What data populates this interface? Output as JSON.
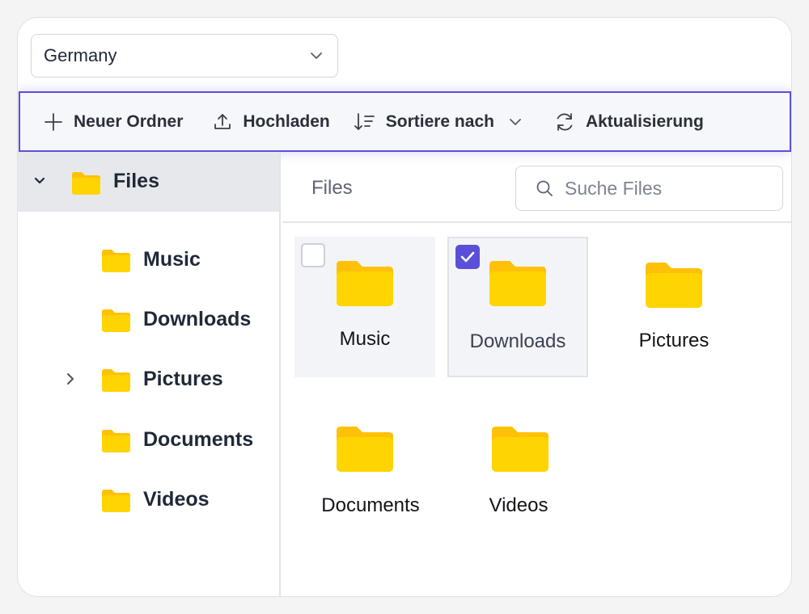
{
  "colors": {
    "accent": "#5b4fd8",
    "folder": "#ffd400",
    "folder_tab": "#ffc107"
  },
  "country_select": {
    "value": "Germany",
    "icon": "chevron-down-icon"
  },
  "toolbar": {
    "new_folder": "Neuer Ordner",
    "upload": "Hochladen",
    "sort": "Sortiere nach",
    "refresh": "Aktualisierung"
  },
  "sidebar": {
    "root": "Files",
    "items": [
      {
        "label": "Music"
      },
      {
        "label": "Downloads"
      },
      {
        "label": "Pictures"
      },
      {
        "label": "Documents"
      },
      {
        "label": "Videos"
      }
    ]
  },
  "content": {
    "breadcrumb": "Files",
    "search_placeholder": "Suche Files",
    "files": [
      {
        "name": "Music",
        "checked": false
      },
      {
        "name": "Downloads",
        "checked": true
      },
      {
        "name": "Pictures"
      },
      {
        "name": "Documents"
      },
      {
        "name": "Videos"
      }
    ]
  }
}
